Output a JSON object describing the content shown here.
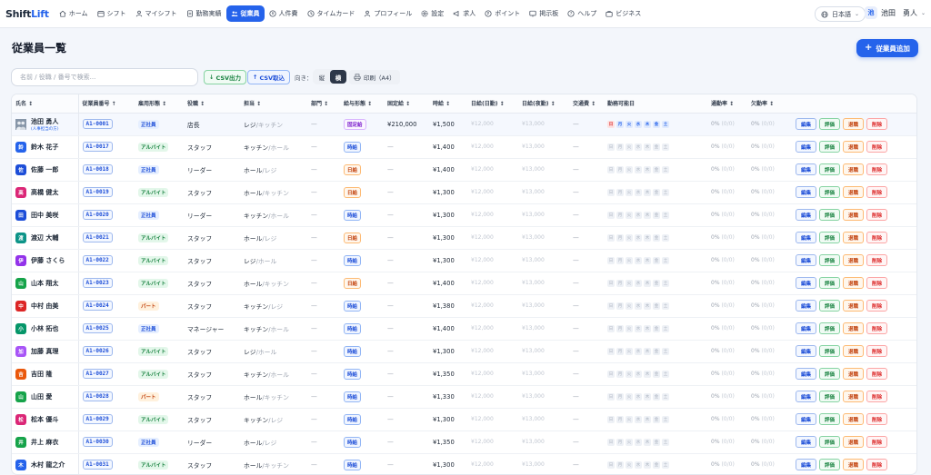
{
  "brand": {
    "part1": "Shift",
    "part2": "Lift"
  },
  "nav": {
    "items": [
      {
        "label": "ホーム",
        "icon": "home-icon"
      },
      {
        "label": "シフト",
        "icon": "calendar-icon"
      },
      {
        "label": "マイシフト",
        "icon": "person-icon"
      },
      {
        "label": "勤務実績",
        "icon": "document-icon"
      },
      {
        "label": "従業員",
        "icon": "people-icon",
        "active": true
      },
      {
        "label": "人件費",
        "icon": "coin-icon"
      },
      {
        "label": "タイムカード",
        "icon": "clock-icon"
      },
      {
        "label": "プロフィール",
        "icon": "person-icon"
      },
      {
        "label": "設定",
        "icon": "gear-icon"
      },
      {
        "label": "求人",
        "icon": "megaphone-icon"
      },
      {
        "label": "ポイント",
        "icon": "points-icon"
      },
      {
        "label": "掲示板",
        "icon": "board-icon"
      },
      {
        "label": "ヘルプ",
        "icon": "help-icon"
      },
      {
        "label": "ビジネス",
        "icon": "briefcase-icon"
      }
    ],
    "language": "日本語",
    "user_initial": "池",
    "user_name": "池田　勇人"
  },
  "page": {
    "title": "従業員一覧",
    "add_button": "従業員追加"
  },
  "toolbar": {
    "search_placeholder": "名前 / 役職 / 番号で検索...",
    "csv_export": "CSV出力",
    "csv_import": "CSV取込",
    "orientation_label": "向き：",
    "portrait": "縦",
    "landscape": "横",
    "print": "印刷（A4）"
  },
  "table": {
    "headers": {
      "name": "氏名",
      "number": "従業員番号",
      "employment": "雇用形態",
      "position": "役職",
      "role": "担当",
      "department": "部門",
      "pay_type": "給与形態",
      "fixed_pay": "固定給",
      "hourly": "時給",
      "daily_day": "日給(日勤)",
      "daily_night": "日給(夜勤)",
      "transport": "交通費",
      "available_days": "勤務可能日",
      "commute_rate": "通勤率",
      "absence_rate": "欠勤率"
    },
    "weekdays": [
      "日",
      "月",
      "火",
      "水",
      "木",
      "金",
      "土"
    ],
    "actions": {
      "edit": "編集",
      "evaluate": "評価",
      "retire": "退職",
      "delete": "削除"
    },
    "rows": [
      {
        "initial": "",
        "name": "池田 勇人",
        "sub": "(人事担当の方)",
        "color": "#7a8899",
        "number": "A1-0001",
        "employment": "正社員",
        "emp_kind": "sei",
        "position": "店長",
        "role_main": "レジ",
        "role_sub": "/キッチン",
        "department": "—",
        "pay": "固定給",
        "pay_kind": "kotei",
        "fixed": "¥210,000",
        "hourly": "¥1,500",
        "daily_day": "¥12,000",
        "daily_night": "¥13,000",
        "transport": "—",
        "days_on": [
          0,
          1,
          2,
          3,
          4,
          5,
          6
        ],
        "commute": "0%",
        "commute_sub": "(0/0)",
        "absence": "0%",
        "absence_sub": "(0/0)"
      },
      {
        "initial": "鈴",
        "name": "鈴木 花子",
        "sub": "",
        "color": "#2563eb",
        "number": "A1-0017",
        "employment": "アルバイト",
        "emp_kind": "arb",
        "position": "スタッフ",
        "role_main": "キッチン",
        "role_sub": "/ホール",
        "department": "—",
        "pay": "時給",
        "pay_kind": "jikyu",
        "fixed": "—",
        "hourly": "¥1,400",
        "daily_day": "¥12,000",
        "daily_night": "¥13,000",
        "transport": "—",
        "days_on": [],
        "commute": "0%",
        "commute_sub": "(0/0)",
        "absence": "0%",
        "absence_sub": "(0/0)"
      },
      {
        "initial": "佐",
        "name": "佐藤 一郎",
        "sub": "",
        "color": "#1d4ed8",
        "number": "A1-0018",
        "employment": "正社員",
        "emp_kind": "sei",
        "position": "リーダー",
        "role_main": "ホール",
        "role_sub": "/レジ",
        "department": "—",
        "pay": "日給",
        "pay_kind": "nikkyu",
        "fixed": "—",
        "hourly": "¥1,400",
        "daily_day": "¥12,000",
        "daily_night": "¥13,000",
        "transport": "—",
        "days_on": [],
        "commute": "0%",
        "commute_sub": "(0/0)",
        "absence": "0%",
        "absence_sub": "(0/0)"
      },
      {
        "initial": "高",
        "name": "高橋 健太",
        "sub": "",
        "color": "#db2777",
        "number": "A1-0019",
        "employment": "アルバイト",
        "emp_kind": "arb",
        "position": "スタッフ",
        "role_main": "ホール",
        "role_sub": "/キッチン",
        "department": "—",
        "pay": "日給",
        "pay_kind": "nikkyu",
        "fixed": "—",
        "hourly": "¥1,300",
        "daily_day": "¥12,000",
        "daily_night": "¥13,000",
        "transport": "—",
        "days_on": [],
        "commute": "0%",
        "commute_sub": "(0/0)",
        "absence": "0%",
        "absence_sub": "(0/0)"
      },
      {
        "initial": "田",
        "name": "田中 美咲",
        "sub": "",
        "color": "#1d4ed8",
        "number": "A1-0020",
        "employment": "正社員",
        "emp_kind": "sei",
        "position": "リーダー",
        "role_main": "キッチン",
        "role_sub": "/ホール",
        "department": "—",
        "pay": "時給",
        "pay_kind": "jikyu",
        "fixed": "—",
        "hourly": "¥1,300",
        "daily_day": "¥12,000",
        "daily_night": "¥13,000",
        "transport": "—",
        "days_on": [],
        "commute": "0%",
        "commute_sub": "(0/0)",
        "absence": "0%",
        "absence_sub": "(0/0)"
      },
      {
        "initial": "渡",
        "name": "渡辺 大輔",
        "sub": "",
        "color": "#0d9488",
        "number": "A1-0021",
        "employment": "アルバイト",
        "emp_kind": "arb",
        "position": "スタッフ",
        "role_main": "ホール",
        "role_sub": "/レジ",
        "department": "—",
        "pay": "日給",
        "pay_kind": "nikkyu",
        "fixed": "—",
        "hourly": "¥1,300",
        "daily_day": "¥12,000",
        "daily_night": "¥13,000",
        "transport": "—",
        "days_on": [],
        "commute": "0%",
        "commute_sub": "(0/0)",
        "absence": "0%",
        "absence_sub": "(0/0)"
      },
      {
        "initial": "伊",
        "name": "伊藤 さくら",
        "sub": "",
        "color": "#9333ea",
        "number": "A1-0022",
        "employment": "アルバイト",
        "emp_kind": "arb",
        "position": "スタッフ",
        "role_main": "レジ",
        "role_sub": "/ホール",
        "department": "—",
        "pay": "時給",
        "pay_kind": "jikyu",
        "fixed": "—",
        "hourly": "¥1,300",
        "daily_day": "¥12,000",
        "daily_night": "¥13,000",
        "transport": "—",
        "days_on": [],
        "commute": "0%",
        "commute_sub": "(0/0)",
        "absence": "0%",
        "absence_sub": "(0/0)"
      },
      {
        "initial": "山",
        "name": "山本 翔太",
        "sub": "",
        "color": "#16a34a",
        "number": "A1-0023",
        "employment": "アルバイト",
        "emp_kind": "arb",
        "position": "スタッフ",
        "role_main": "ホール",
        "role_sub": "/キッチン",
        "department": "—",
        "pay": "日給",
        "pay_kind": "nikkyu",
        "fixed": "—",
        "hourly": "¥1,400",
        "daily_day": "¥12,000",
        "daily_night": "¥13,000",
        "transport": "—",
        "days_on": [],
        "commute": "0%",
        "commute_sub": "(0/0)",
        "absence": "0%",
        "absence_sub": "(0/0)"
      },
      {
        "initial": "中",
        "name": "中村 由美",
        "sub": "",
        "color": "#dc2626",
        "number": "A1-0024",
        "employment": "パート",
        "emp_kind": "pat",
        "position": "スタッフ",
        "role_main": "キッチン",
        "role_sub": "/レジ",
        "department": "—",
        "pay": "時給",
        "pay_kind": "jikyu",
        "fixed": "—",
        "hourly": "¥1,380",
        "daily_day": "¥12,000",
        "daily_night": "¥13,000",
        "transport": "—",
        "days_on": [],
        "commute": "0%",
        "commute_sub": "(0/0)",
        "absence": "0%",
        "absence_sub": "(0/0)"
      },
      {
        "initial": "小",
        "name": "小林 拓也",
        "sub": "",
        "color": "#059669",
        "number": "A1-0025",
        "employment": "正社員",
        "emp_kind": "sei",
        "position": "マネージャー",
        "role_main": "キッチン",
        "role_sub": "/ホール",
        "department": "—",
        "pay": "時給",
        "pay_kind": "jikyu",
        "fixed": "—",
        "hourly": "¥1,400",
        "daily_day": "¥12,000",
        "daily_night": "¥13,000",
        "transport": "—",
        "days_on": [],
        "commute": "0%",
        "commute_sub": "(0/0)",
        "absence": "0%",
        "absence_sub": "(0/0)"
      },
      {
        "initial": "加",
        "name": "加藤 真理",
        "sub": "",
        "color": "#a855f7",
        "number": "A1-0026",
        "employment": "アルバイト",
        "emp_kind": "arb",
        "position": "スタッフ",
        "role_main": "レジ",
        "role_sub": "/ホール",
        "department": "—",
        "pay": "時給",
        "pay_kind": "jikyu",
        "fixed": "—",
        "hourly": "¥1,300",
        "daily_day": "¥12,000",
        "daily_night": "¥13,000",
        "transport": "—",
        "days_on": [],
        "commute": "0%",
        "commute_sub": "(0/0)",
        "absence": "0%",
        "absence_sub": "(0/0)"
      },
      {
        "initial": "吉",
        "name": "吉田 隆",
        "sub": "",
        "color": "#ea580c",
        "number": "A1-0027",
        "employment": "アルバイト",
        "emp_kind": "arb",
        "position": "スタッフ",
        "role_main": "キッチン",
        "role_sub": "/ホール",
        "department": "—",
        "pay": "時給",
        "pay_kind": "jikyu",
        "fixed": "—",
        "hourly": "¥1,350",
        "daily_day": "¥12,000",
        "daily_night": "¥13,000",
        "transport": "—",
        "days_on": [],
        "commute": "0%",
        "commute_sub": "(0/0)",
        "absence": "0%",
        "absence_sub": "(0/0)"
      },
      {
        "initial": "山",
        "name": "山田 愛",
        "sub": "",
        "color": "#16a34a",
        "number": "A1-0028",
        "employment": "パート",
        "emp_kind": "pat",
        "position": "スタッフ",
        "role_main": "ホール",
        "role_sub": "/キッチン",
        "department": "—",
        "pay": "時給",
        "pay_kind": "jikyu",
        "fixed": "—",
        "hourly": "¥1,330",
        "daily_day": "¥12,000",
        "daily_night": "¥13,000",
        "transport": "—",
        "days_on": [],
        "commute": "0%",
        "commute_sub": "(0/0)",
        "absence": "0%",
        "absence_sub": "(0/0)"
      },
      {
        "initial": "松",
        "name": "松本 優斗",
        "sub": "",
        "color": "#db2777",
        "number": "A1-0029",
        "employment": "アルバイト",
        "emp_kind": "arb",
        "position": "スタッフ",
        "role_main": "キッチン",
        "role_sub": "/レジ",
        "department": "—",
        "pay": "時給",
        "pay_kind": "jikyu",
        "fixed": "—",
        "hourly": "¥1,300",
        "daily_day": "¥12,000",
        "daily_night": "¥13,000",
        "transport": "—",
        "days_on": [],
        "commute": "0%",
        "commute_sub": "(0/0)",
        "absence": "0%",
        "absence_sub": "(0/0)"
      },
      {
        "initial": "井",
        "name": "井上 麻衣",
        "sub": "",
        "color": "#16a34a",
        "number": "A1-0030",
        "employment": "正社員",
        "emp_kind": "sei",
        "position": "リーダー",
        "role_main": "ホール",
        "role_sub": "/レジ",
        "department": "—",
        "pay": "時給",
        "pay_kind": "jikyu",
        "fixed": "—",
        "hourly": "¥1,350",
        "daily_day": "¥12,000",
        "daily_night": "¥13,000",
        "transport": "—",
        "days_on": [],
        "commute": "0%",
        "commute_sub": "(0/0)",
        "absence": "0%",
        "absence_sub": "(0/0)"
      },
      {
        "initial": "木",
        "name": "木村 龍之介",
        "sub": "",
        "color": "#2563eb",
        "number": "A1-0031",
        "employment": "アルバイト",
        "emp_kind": "arb",
        "position": "スタッフ",
        "role_main": "ホール",
        "role_sub": "/キッチン",
        "department": "—",
        "pay": "時給",
        "pay_kind": "jikyu",
        "fixed": "—",
        "hourly": "¥1,300",
        "daily_day": "¥12,000",
        "daily_night": "¥13,000",
        "transport": "—",
        "days_on": [],
        "commute": "0%",
        "commute_sub": "(0/0)",
        "absence": "0%",
        "absence_sub": "(0/0)"
      }
    ]
  }
}
